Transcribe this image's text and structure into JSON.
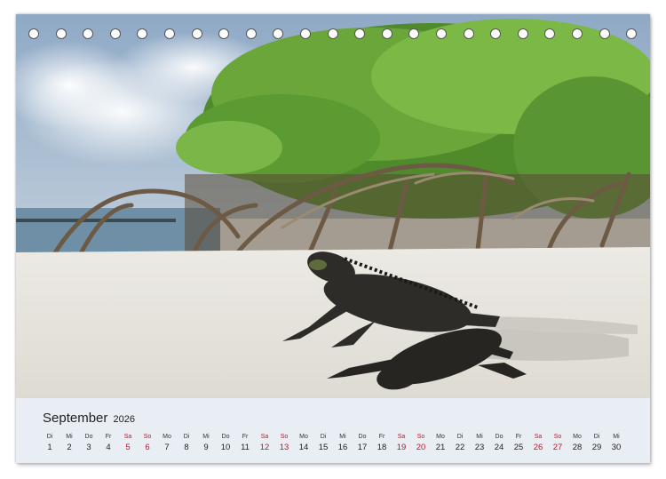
{
  "calendar": {
    "month": "September",
    "year": "2026",
    "days": [
      {
        "wd": "Di",
        "d": "1",
        "we": false
      },
      {
        "wd": "Mi",
        "d": "2",
        "we": false
      },
      {
        "wd": "Do",
        "d": "3",
        "we": false
      },
      {
        "wd": "Fr",
        "d": "4",
        "we": false
      },
      {
        "wd": "Sa",
        "d": "5",
        "we": true
      },
      {
        "wd": "So",
        "d": "6",
        "we": true
      },
      {
        "wd": "Mo",
        "d": "7",
        "we": false
      },
      {
        "wd": "Di",
        "d": "8",
        "we": false
      },
      {
        "wd": "Mi",
        "d": "9",
        "we": false
      },
      {
        "wd": "Do",
        "d": "10",
        "we": false
      },
      {
        "wd": "Fr",
        "d": "11",
        "we": false
      },
      {
        "wd": "Sa",
        "d": "12",
        "we": true
      },
      {
        "wd": "So",
        "d": "13",
        "we": true
      },
      {
        "wd": "Mo",
        "d": "14",
        "we": false
      },
      {
        "wd": "Di",
        "d": "15",
        "we": false
      },
      {
        "wd": "Mi",
        "d": "16",
        "we": false
      },
      {
        "wd": "Do",
        "d": "17",
        "we": false
      },
      {
        "wd": "Fr",
        "d": "18",
        "we": false
      },
      {
        "wd": "Sa",
        "d": "19",
        "we": true
      },
      {
        "wd": "So",
        "d": "20",
        "we": true
      },
      {
        "wd": "Mo",
        "d": "21",
        "we": false
      },
      {
        "wd": "Di",
        "d": "22",
        "we": false
      },
      {
        "wd": "Mi",
        "d": "23",
        "we": false
      },
      {
        "wd": "Do",
        "d": "24",
        "we": false
      },
      {
        "wd": "Fr",
        "d": "25",
        "we": false
      },
      {
        "wd": "Sa",
        "d": "26",
        "we": true
      },
      {
        "wd": "So",
        "d": "27",
        "we": true
      },
      {
        "wd": "Mo",
        "d": "28",
        "we": false
      },
      {
        "wd": "Di",
        "d": "29",
        "we": false
      },
      {
        "wd": "Mi",
        "d": "30",
        "we": false
      }
    ]
  },
  "colors": {
    "weekend": "#b0202a",
    "calendar_bg": "#e8eef4"
  }
}
